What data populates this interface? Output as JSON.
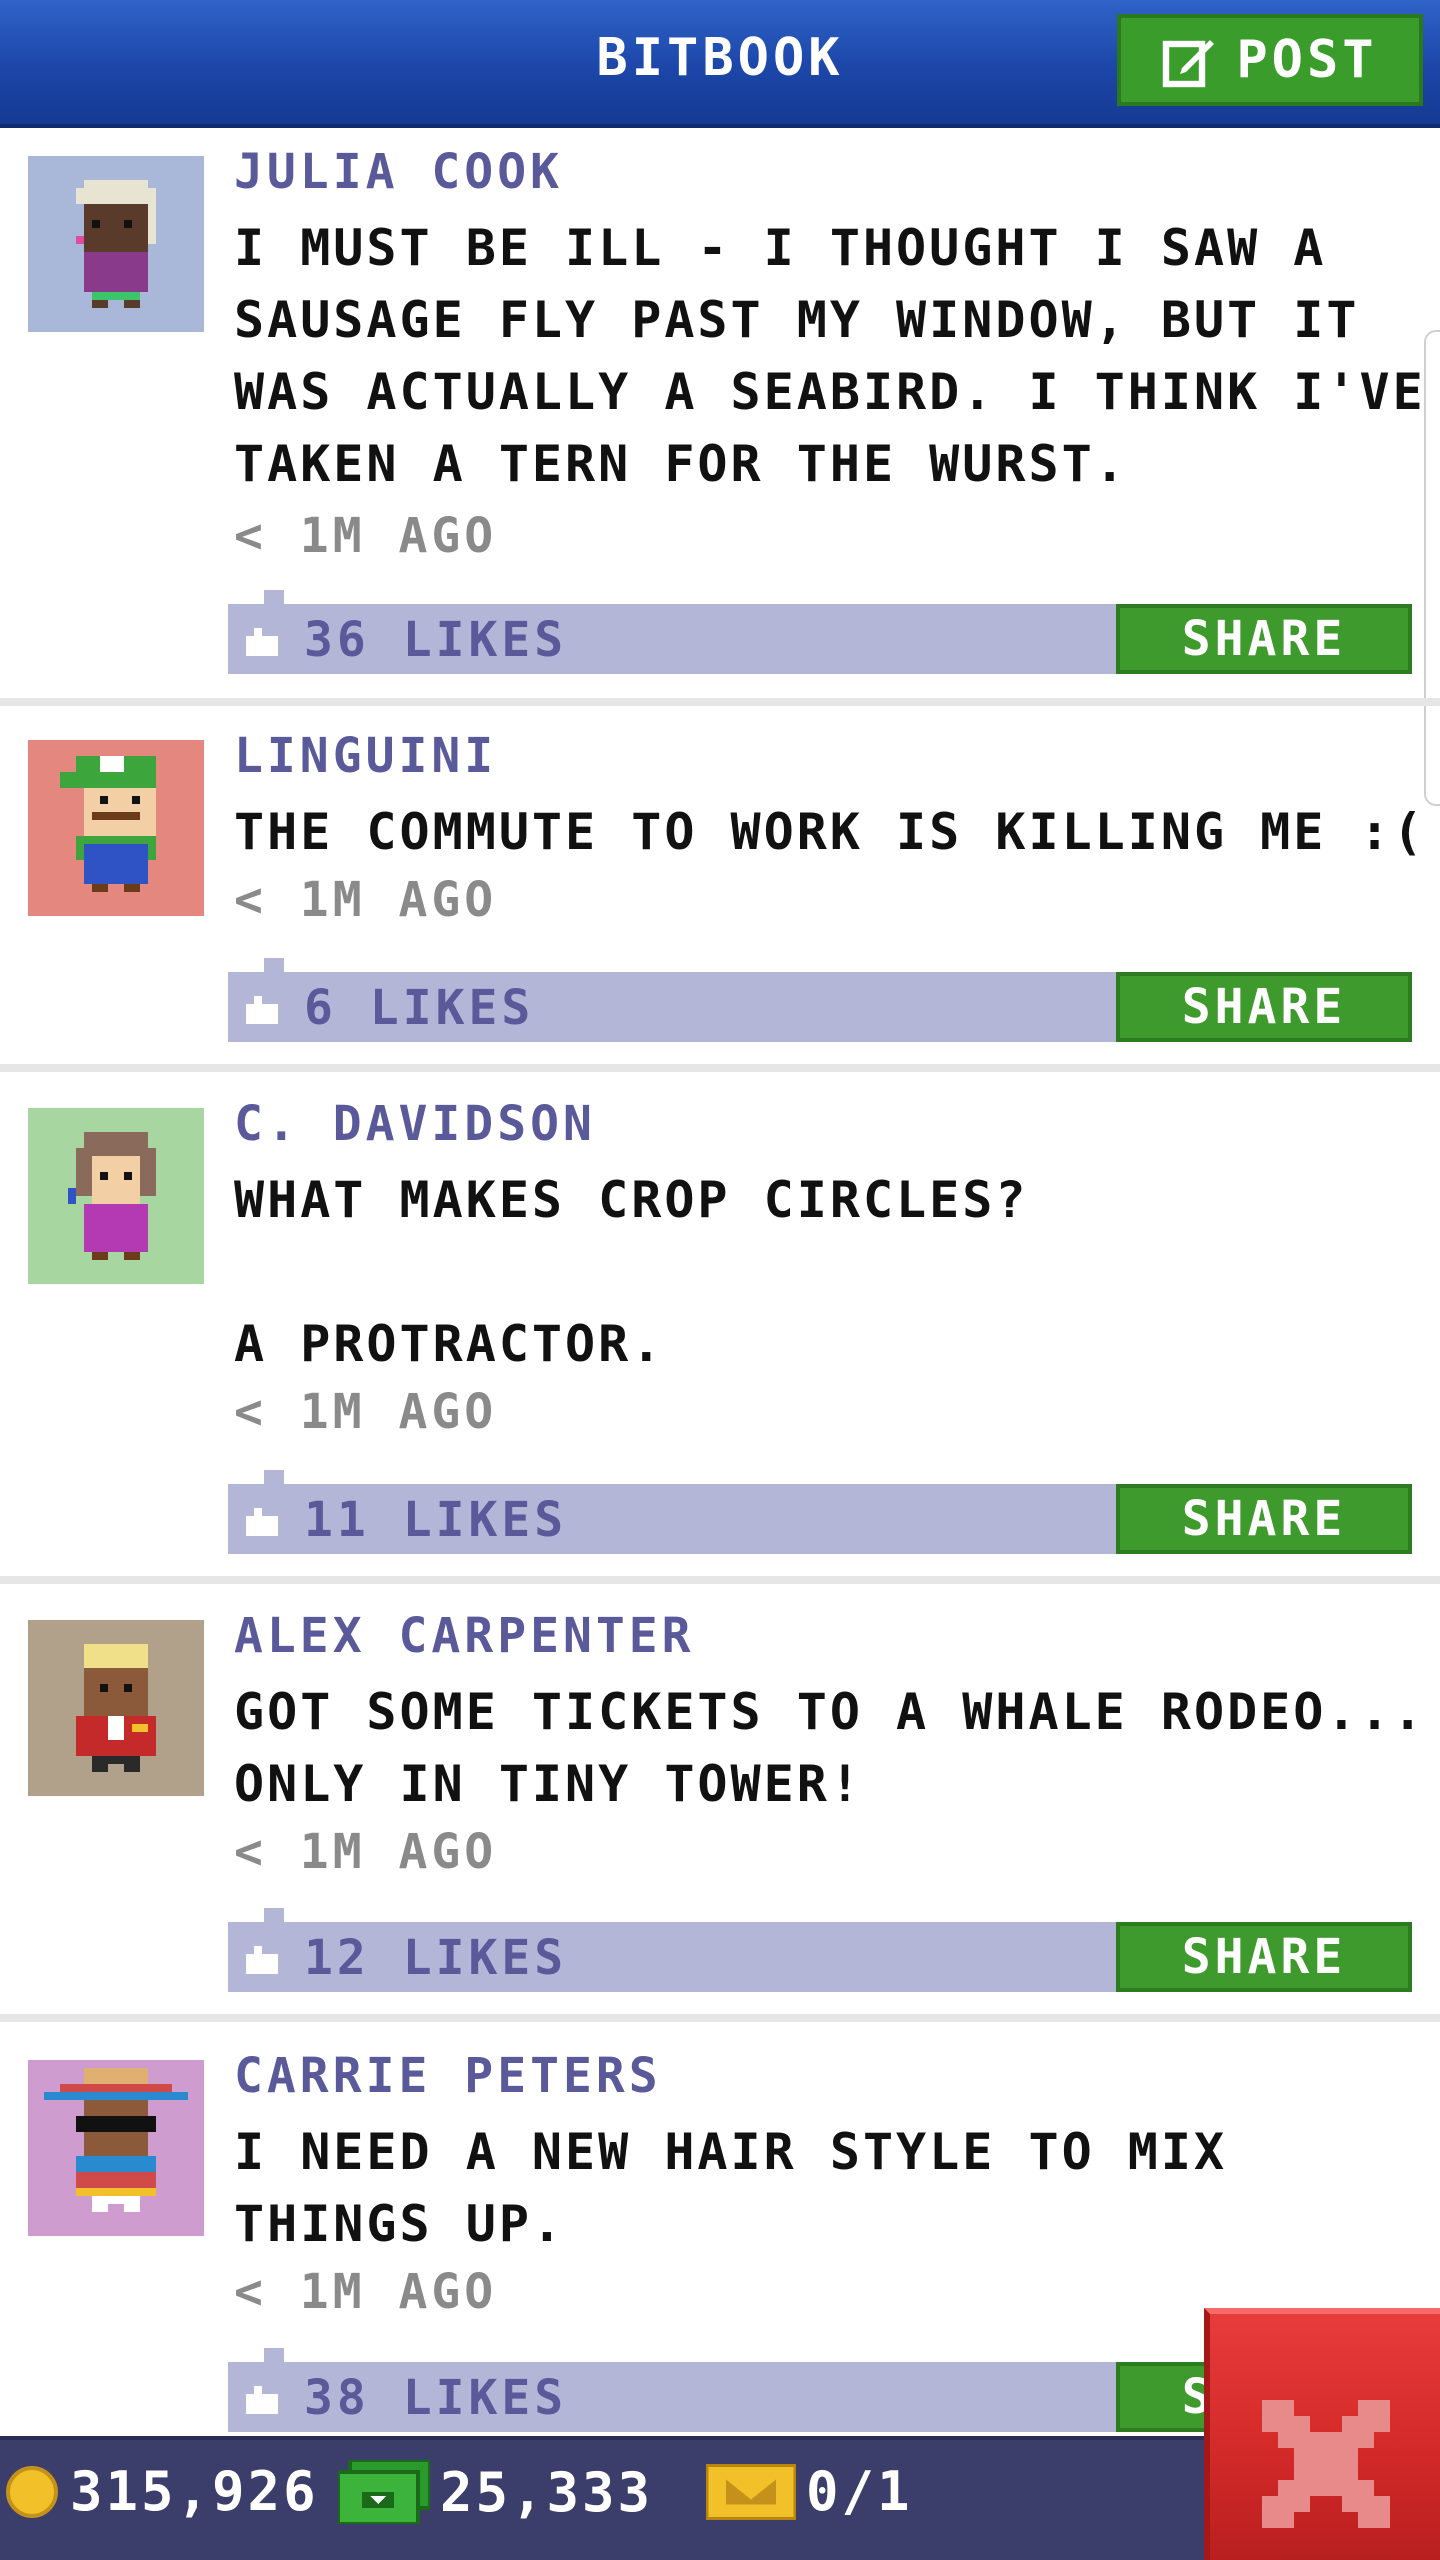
{
  "header": {
    "title": "BITBOOK",
    "post_label": "POST"
  },
  "colors": {
    "header_blue": "#1c46a8",
    "green_button": "#3f9a2e",
    "like_bar": "#b4b6d8",
    "author_text": "#5a5a9a",
    "close_red": "#d12828",
    "bottom_bar": "#3b3d6b"
  },
  "posts": [
    {
      "author": "JULIA COOK",
      "avatar_icon": "julia-cook-avatar",
      "avatar_bg": "#a9b7d9",
      "text": "I MUST BE ILL - I THOUGHT I SAW A\nSAUSAGE FLY PAST MY WINDOW, BUT IT\nWAS ACTUALLY A SEABIRD. I THINK I'VE\nTAKEN A TERN FOR THE WURST.",
      "time": "< 1M AGO",
      "likes": "36 LIKES",
      "share_label": "SHARE"
    },
    {
      "author": "LINGUINI",
      "avatar_icon": "linguini-avatar",
      "avatar_bg": "#e4877f",
      "text": "THE COMMUTE TO WORK IS KILLING ME :(",
      "time": "< 1M AGO",
      "likes": "6 LIKES",
      "share_label": "SHARE"
    },
    {
      "author": "C. DAVIDSON",
      "avatar_icon": "c-davidson-avatar",
      "avatar_bg": "#a8d6a0",
      "text": "WHAT MAKES CROP CIRCLES?\n\nA PROTRACTOR.",
      "time": "< 1M AGO",
      "likes": "11 LIKES",
      "share_label": "SHARE"
    },
    {
      "author": "ALEX CARPENTER",
      "avatar_icon": "alex-carpenter-avatar",
      "avatar_bg": "#b1a18a",
      "text": "GOT SOME TICKETS TO A WHALE RODEO...\nONLY IN TINY TOWER!",
      "time": "< 1M AGO",
      "likes": "12 LIKES",
      "share_label": "SHARE"
    },
    {
      "author": "CARRIE PETERS",
      "avatar_icon": "carrie-peters-avatar",
      "avatar_bg": "#cf9ccf",
      "text": "I NEED A NEW HAIR STYLE TO MIX\nTHINGS UP.",
      "time": "< 1M AGO",
      "likes": "38 LIKES",
      "share_label": "SHARE"
    }
  ],
  "bottom_bar": {
    "coins": "315,926",
    "bux": "25,333",
    "tickets": "0/1"
  }
}
